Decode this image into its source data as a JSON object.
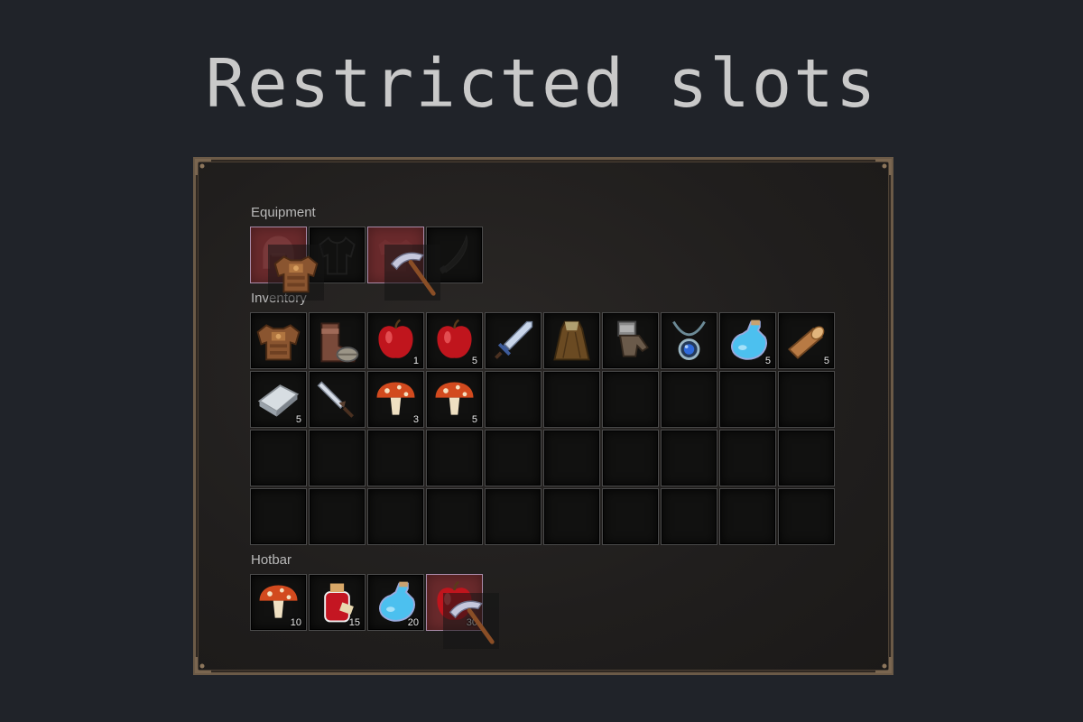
{
  "title": "Restricted slots",
  "sections": {
    "equipment": "Equipment",
    "inventory": "Inventory",
    "hotbar": "Hotbar"
  },
  "colors": {
    "background": "#202329",
    "panel_border": "#6b5a47",
    "slot_restricted": "#6a2a2c",
    "slot_empty": "#111110"
  },
  "equipment": [
    {
      "icon": "helmet-silhouette-icon",
      "restricted": true
    },
    {
      "icon": "shirt-silhouette-icon",
      "restricted": false
    },
    {
      "icon": "armor-silhouette-icon",
      "restricted": true
    },
    {
      "icon": "weapon-silhouette-icon",
      "restricted": false
    }
  ],
  "inventory": [
    {
      "icon": "chest-armor-icon",
      "count": ""
    },
    {
      "icon": "boots-icon",
      "count": ""
    },
    {
      "icon": "apple-icon",
      "count": "1"
    },
    {
      "icon": "apple-icon",
      "count": "5"
    },
    {
      "icon": "sword-icon",
      "count": ""
    },
    {
      "icon": "cloak-icon",
      "count": ""
    },
    {
      "icon": "gauntlet-icon",
      "count": ""
    },
    {
      "icon": "amulet-icon",
      "count": ""
    },
    {
      "icon": "mana-potion-icon",
      "count": "5"
    },
    {
      "icon": "wood-log-icon",
      "count": "5"
    },
    {
      "icon": "iron-ingot-icon",
      "count": "5"
    },
    {
      "icon": "dagger-icon",
      "count": ""
    },
    {
      "icon": "mushroom-icon",
      "count": "3"
    },
    {
      "icon": "mushroom-icon",
      "count": "5"
    }
  ],
  "inventory_total_slots": 40,
  "hotbar": [
    {
      "icon": "mushroom-icon",
      "count": "10",
      "restricted": false
    },
    {
      "icon": "health-potion-icon",
      "count": "15",
      "restricted": false
    },
    {
      "icon": "mana-potion-icon",
      "count": "20",
      "restricted": false
    },
    {
      "icon": "apple-icon",
      "count": "30",
      "restricted": true
    }
  ],
  "dragging": [
    {
      "icon": "chest-armor-icon",
      "target": "equipment-slot-1"
    },
    {
      "icon": "pickaxe-icon",
      "target": "equipment-slot-3"
    },
    {
      "icon": "pickaxe-icon",
      "target": "hotbar-slot-4"
    }
  ]
}
